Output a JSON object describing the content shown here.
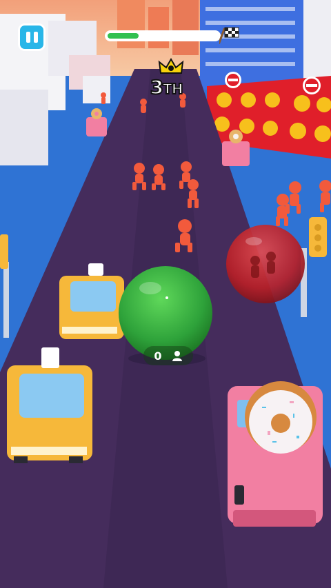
{
  "hud": {
    "pause_icon": "pause-icon",
    "progress": 0.28,
    "finish_icon": "checkered-flag-icon",
    "rank_number": "3",
    "rank_suffix": "TH",
    "leader_icon": "crown-icon"
  },
  "player_ball": {
    "count": "0",
    "count_icon": "person-icon",
    "color": "#2fa53a"
  },
  "rival_ball": {
    "color": "#c0262c"
  },
  "colors": {
    "road": "#452c5c",
    "water": "#2f73d4",
    "runner": "#f25a3c",
    "taxi": "#f6b83a",
    "donut_truck": "#f27fa2"
  }
}
